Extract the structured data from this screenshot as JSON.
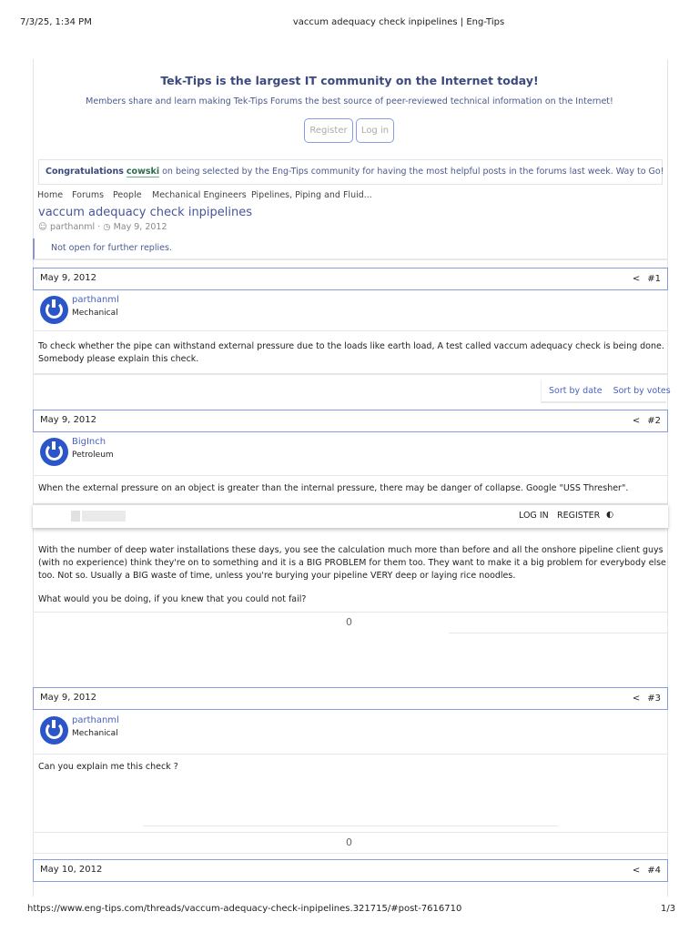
{
  "print_header": {
    "datetime": "7/3/25, 1:34 PM",
    "title": "vaccum adequacy check inpipelines | Eng-Tips"
  },
  "print_footer": {
    "url": "https://www.eng-tips.com/threads/vaccum-adequacy-check-inpipelines.321715/#post-7616710",
    "page": "1/3"
  },
  "banner": {
    "title": "Tek-Tips is the largest IT community on the Internet today!",
    "subtitle": "Members share and learn making Tek-Tips Forums the best source of peer-reviewed technical information on the Internet!",
    "register": "Register",
    "login": "Log in"
  },
  "congrats": {
    "lead": "Congratulations",
    "user": "cowski",
    "rest": "on being selected by the Eng-Tips community for having the most helpful posts in the forums last week. Way to Go!"
  },
  "breadcrumb": [
    "Home",
    "Forums",
    "People",
    "Mechanical Engineers",
    "Pipelines, Piping and Fluid..."
  ],
  "thread": {
    "title": "vaccum adequacy check inpipelines",
    "author": "parthanml",
    "date": "May 9, 2012",
    "closed": "Not open for further replies."
  },
  "sort": {
    "by_date": "Sort by date",
    "by_votes": "Sort by votes"
  },
  "sticky": {
    "login": "LOG IN",
    "register": "REGISTER"
  },
  "posts": [
    {
      "date": "May 9, 2012",
      "num": "#1",
      "user": "parthanml",
      "role": "Mechanical",
      "body": "To check whether the pipe can withstand external pressure due to the loads like earth load, A test called vaccum adequacy check is being done. Somebody please explain this check."
    },
    {
      "date": "May 9, 2012",
      "num": "#2",
      "user": "BigInch",
      "role": "Petroleum",
      "body": "When the external pressure on an object is greater than the internal pressure, there may be danger of collapse. Google \"USS Thresher\".",
      "body2": "With the number of deep water installations these days, you see the calculation much more than before and all the onshore pipeline client guys (with no experience) think they're on to something and it is a BIG PROBLEM for them too. They want to make it a big problem for everybody else too. Not so. Usually a BIG waste of time, unless you're burying your pipeline VERY deep or laying rice noodles.",
      "signature": "What would you be doing, if you knew that you could not fail?",
      "votes": "0"
    },
    {
      "date": "May 9, 2012",
      "num": "#3",
      "user": "parthanml",
      "role": "Mechanical",
      "body": "Can you explain me this check ?",
      "votes": "0"
    },
    {
      "date": "May 10, 2012",
      "num": "#4"
    }
  ]
}
